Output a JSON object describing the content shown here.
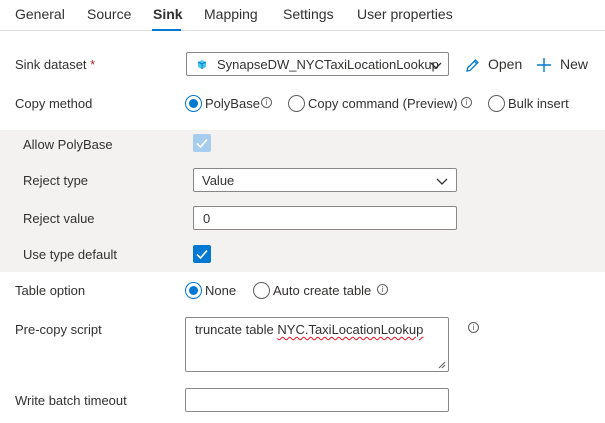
{
  "tabs": [
    {
      "label": "General",
      "active": false
    },
    {
      "label": "Source",
      "active": false
    },
    {
      "label": "Sink",
      "active": true
    },
    {
      "label": "Mapping",
      "active": false
    },
    {
      "label": "Settings",
      "active": false
    },
    {
      "label": "User properties",
      "active": false
    }
  ],
  "sink_dataset": {
    "label": "Sink dataset",
    "required_marker": "*",
    "value": "SynapseDW_NYCTaxiLocationLookup",
    "icon": "synapse-dataset-icon",
    "open_label": "Open",
    "new_label": "New"
  },
  "copy_method": {
    "label": "Copy method",
    "options": [
      {
        "label": "PolyBase",
        "selected": true,
        "info": true
      },
      {
        "label": "Copy command (Preview)",
        "selected": false,
        "info": true
      },
      {
        "label": "Bulk insert",
        "selected": false,
        "info": false
      }
    ]
  },
  "polybase": {
    "allow_label": "Allow PolyBase",
    "allow_checked": true,
    "reject_type_label": "Reject type",
    "reject_type_value": "Value",
    "reject_value_label": "Reject value",
    "reject_value": "0",
    "use_type_default_label": "Use type default",
    "use_type_default_checked": true
  },
  "table_option": {
    "label": "Table option",
    "options": [
      {
        "label": "None",
        "selected": true
      },
      {
        "label": "Auto create table",
        "selected": false
      }
    ]
  },
  "pre_copy_script": {
    "label": "Pre-copy script",
    "value_prefix": "truncate table ",
    "value_flagged": "NYC.TaxiLocationLookup"
  },
  "write_batch_timeout": {
    "label": "Write batch timeout",
    "value": ""
  },
  "colors": {
    "accent": "#0078d4",
    "border": "#8a8886",
    "panel_bg": "#f3f2f1",
    "required": "#a4262c",
    "spellcheck": "#e81123"
  }
}
